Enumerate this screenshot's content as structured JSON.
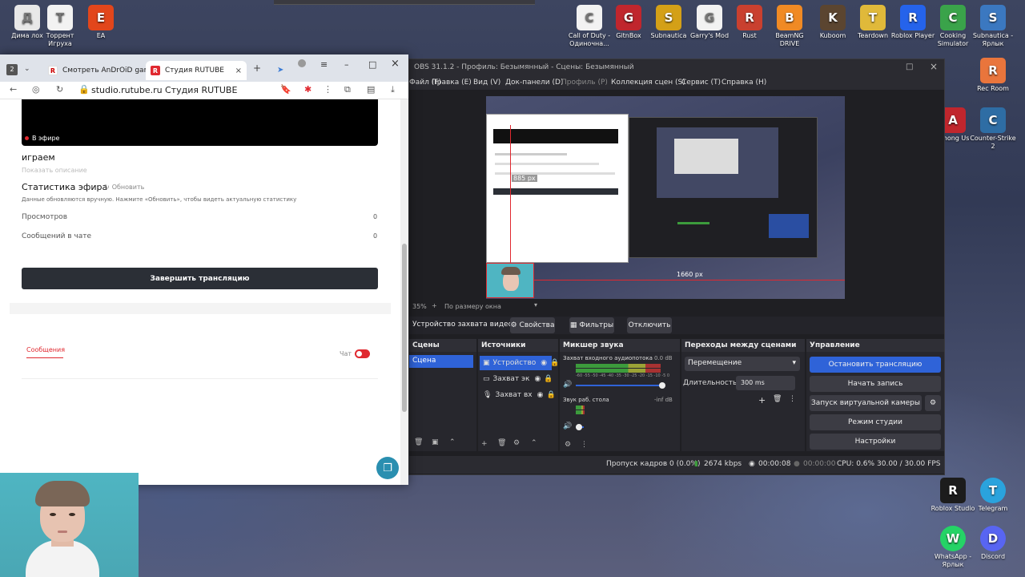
{
  "desktop": {
    "icons_top": [
      {
        "label": "Дима лох",
        "icon": "recycle-bin-icon",
        "color": "#e8e8e8"
      },
      {
        "label": "Торрент Игруха",
        "icon": "file-icon",
        "color": "#f2f2f2"
      },
      {
        "label": "EA",
        "icon": "ea-icon",
        "color": "#e2461b"
      },
      {
        "label": "Call of Duty - Одиночна...",
        "icon": "file-icon",
        "color": "#f2f2f2"
      },
      {
        "label": "GitnBox",
        "icon": "gitnbox-icon",
        "color": "#c0262d"
      },
      {
        "label": "Subnautica",
        "icon": "subnautica-icon",
        "color": "#d4a017"
      },
      {
        "label": "Garry's Mod",
        "icon": "file-icon",
        "color": "#f2f2f2"
      },
      {
        "label": "Rust",
        "icon": "rust-icon",
        "color": "#c9402f"
      },
      {
        "label": "BeamNG DRIVE",
        "icon": "beamng-icon",
        "color": "#f08a24"
      },
      {
        "label": "Kuboom",
        "icon": "kuboom-icon",
        "color": "#5b4530"
      },
      {
        "label": "Teardown",
        "icon": "teardown-icon",
        "color": "#e0b93a"
      },
      {
        "label": "Roblox Player",
        "icon": "roblox-icon",
        "color": "#2563eb"
      },
      {
        "label": "Cooking Simulator",
        "icon": "cooking-icon",
        "color": "#3aa34a"
      },
      {
        "label": "Subnautica - Ярлык",
        "icon": "subnautica-icon",
        "color": "#3b78c0"
      }
    ],
    "icons_right": [
      {
        "label": "Rec Room",
        "icon": "recroom-icon",
        "color": "#e9753c"
      },
      {
        "label": "Among Us",
        "icon": "amongus-icon",
        "color": "#c0262d"
      },
      {
        "label": "Counter-Strike 2",
        "icon": "cs2-icon",
        "color": "#2e6da4"
      },
      {
        "label": "Roblox Studio",
        "icon": "roblox-studio-icon",
        "color": "#1c1c1c"
      },
      {
        "label": "Telegram",
        "icon": "telegram-icon",
        "color": "#2aa3dd"
      },
      {
        "label": "WhatsApp - Ярлык",
        "icon": "whatsapp-icon",
        "color": "#25d366"
      },
      {
        "label": "Discord",
        "icon": "discord-icon",
        "color": "#5865f2"
      }
    ]
  },
  "browser": {
    "tab_count": "2",
    "tabs": [
      {
        "label": "Смотреть AnDrOiD gam",
        "active": false
      },
      {
        "label": "Студия RUTUBE",
        "active": true
      }
    ],
    "url": "studio.rutube.ru",
    "page_title": "Студия RUTUBE",
    "live_badge": "В эфире",
    "stream_title": "играем",
    "show_description": "Показать описание",
    "stats_title": "Статистика эфира",
    "refresh_label": "Обновить",
    "stats_note": "Данные обновляются вручную. Нажмите «Обновить», чтобы видеть актуальную статистику",
    "views_label": "Просмотров",
    "views_value": "0",
    "messages_label": "Сообщений в чате",
    "messages_value": "0",
    "end_stream_button": "Завершить трансляцию",
    "tab_messages": "Сообщения",
    "chat_toggle_label": "Чат",
    "chat_toggle_on": true
  },
  "obs": {
    "title": "OBS 31.1.2 - Профиль: Безымянный - Сцены: Безымянный",
    "menu": [
      "Файл (F)",
      "Правка (E)",
      "Вид (V)",
      "Док-панели (D)",
      "Профиль (P)",
      "Коллекция сцен (S)",
      "Сервис (T)",
      "Справка (H)"
    ],
    "zoom": "35%",
    "fit_label": "По размеру окна",
    "preview_measure_v": "885 px",
    "preview_measure_h": "1660 px",
    "source_toolbar": {
      "name": "Устройство захвата видео",
      "properties": "Свойства",
      "filters": "Фильтры",
      "disconnect": "Отключить"
    },
    "scenes_title": "Сцены",
    "scene_item": "Сцена",
    "sources_title": "Источники",
    "sources": [
      {
        "name": "Устройство",
        "icon": "camera-icon"
      },
      {
        "name": "Захват эк",
        "icon": "monitor-icon"
      },
      {
        "name": "Захват вх",
        "icon": "microphone-icon"
      }
    ],
    "mixer_title": "Микшер звука",
    "mixer_channels": [
      {
        "name": "Захват входного аудиопотока",
        "db": "0.0 dB",
        "level": 0.93
      },
      {
        "name": "Звук раб. стола",
        "db": "-inf dB",
        "level": 0.1
      }
    ],
    "meter_scale": "-60 -55 -50 -45 -40 -35 -30 -25 -20 -15 -10 -5 0",
    "transitions_title": "Переходы между сценами",
    "transition_select": "Перемещение",
    "duration_label": "Длительность",
    "duration_value": "300 ms",
    "controls_title": "Управление",
    "controls": [
      "Остановить трансляцию",
      "Начать запись",
      "Запуск виртуальной камеры",
      "Режим студии",
      "Настройки"
    ],
    "status": {
      "dropped": "Пропуск кадров 0 (0.0%)",
      "bitrate": "2674 kbps",
      "stream_time": "00:00:08",
      "rec_time": "00:00:00",
      "cpu": "CPU: 0.6%",
      "fps": "30.00 / 30.00 FPS"
    }
  },
  "colors": {
    "rutube_red": "#e0282f",
    "obs_accent": "#2f63d8",
    "dark_button": "#2b2f36"
  }
}
